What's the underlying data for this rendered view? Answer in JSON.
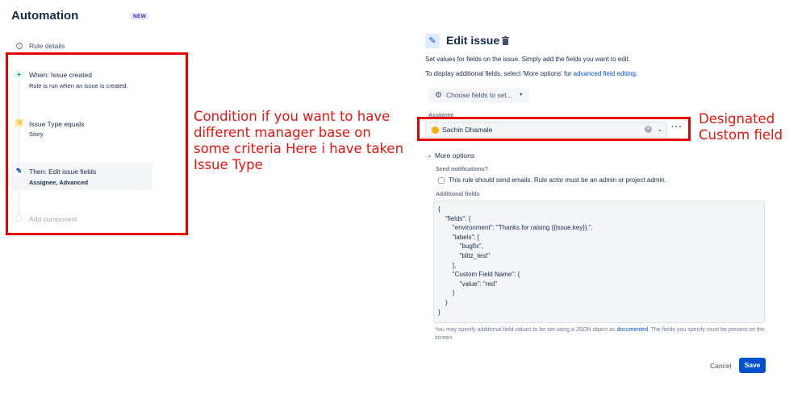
{
  "header": {
    "title": "Automation",
    "badge": "NEW"
  },
  "sidebar": {
    "rule_details": "Rule details",
    "trigger": {
      "title": "When: Issue created",
      "subtitle": "Rule is run when an issue is created."
    },
    "condition": {
      "title": "Issue Type equals",
      "subtitle": "Story"
    },
    "action": {
      "title": "Then: Edit issue fields",
      "subtitle": "Assignee, Advanced"
    },
    "add_component": "Add component"
  },
  "panel": {
    "title": "Edit issue",
    "desc1": "Set values for fields on the issue. Simply add the fields you want to edit.",
    "desc2_prefix": "To display additional fields, select 'More options' for ",
    "desc2_link": "advanced field editing",
    "desc2_suffix": ".",
    "choose_fields": "Choose fields to set...",
    "assignee_label": "Assignee",
    "assignee_value": "Sachin Dhamale",
    "more_options": "More options",
    "send_notifications_label": "Send notifications?",
    "send_notifications_text": "This rule should send emails. Rule actor must be an admin or project admin.",
    "additional_fields_label": "Additional fields",
    "additional_fields_json": "{\n    \"fields\": {\n        \"environment\": \"Thanks for raising {{issue.key}}.\",\n        \"labels\": [\n            \"bugfix\",\n            \"blitz_test\"\n        ],\n        \"Custom Field Name\": {\n            \"value\": \"red\"\n        }\n    }\n}",
    "help_prefix": "You may specify additional field values to be set using a JSON object as ",
    "help_link": "documented",
    "help_suffix": ". The fields you specify must be present on the screen.",
    "cancel": "Cancel",
    "save": "Save"
  },
  "annotations": {
    "left": "Condition if you want to have different manager base on some criteria Here i have taken Issue Type",
    "right": "Designated Custom field"
  },
  "colors": {
    "accent": "#0052cc",
    "annotation": "#e8140f",
    "box": "#e50000"
  }
}
